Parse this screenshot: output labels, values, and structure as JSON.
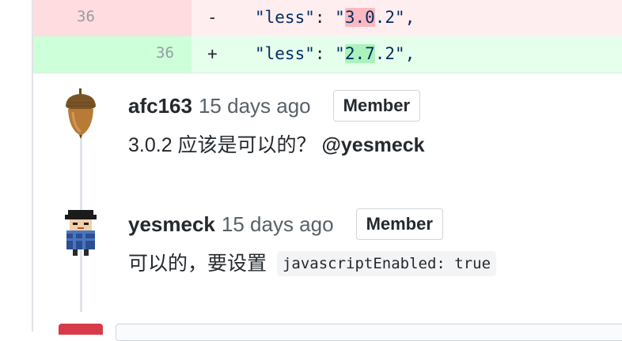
{
  "diff": {
    "deletion": {
      "line_number": "36",
      "marker": "-",
      "key": "\"less\"",
      "sep": ": ",
      "q_open": "\"",
      "version_hl": "3.0",
      "version_rest": ".2",
      "q_close": "\",",
      "color": "#ffeef0"
    },
    "addition": {
      "line_number": "36",
      "marker": "+",
      "key": "\"less\"",
      "sep": ": ",
      "q_open": "\"",
      "version_hl": "2.7",
      "version_rest": ".2",
      "q_close": "\",",
      "color": "#e6ffed"
    }
  },
  "comments": [
    {
      "author": "afc163",
      "timestamp": "15 days ago",
      "role": "Member",
      "avatar_icon": "acorn-icon",
      "body_text": "3.0.2 应该是可以的？",
      "mention": "@yesmeck"
    },
    {
      "author": "yesmeck",
      "timestamp": "15 days ago",
      "role": "Member",
      "avatar_icon": "pixel-person-icon",
      "body_text": "可以的，要设置",
      "code": "javascriptEnabled: true"
    }
  ]
}
